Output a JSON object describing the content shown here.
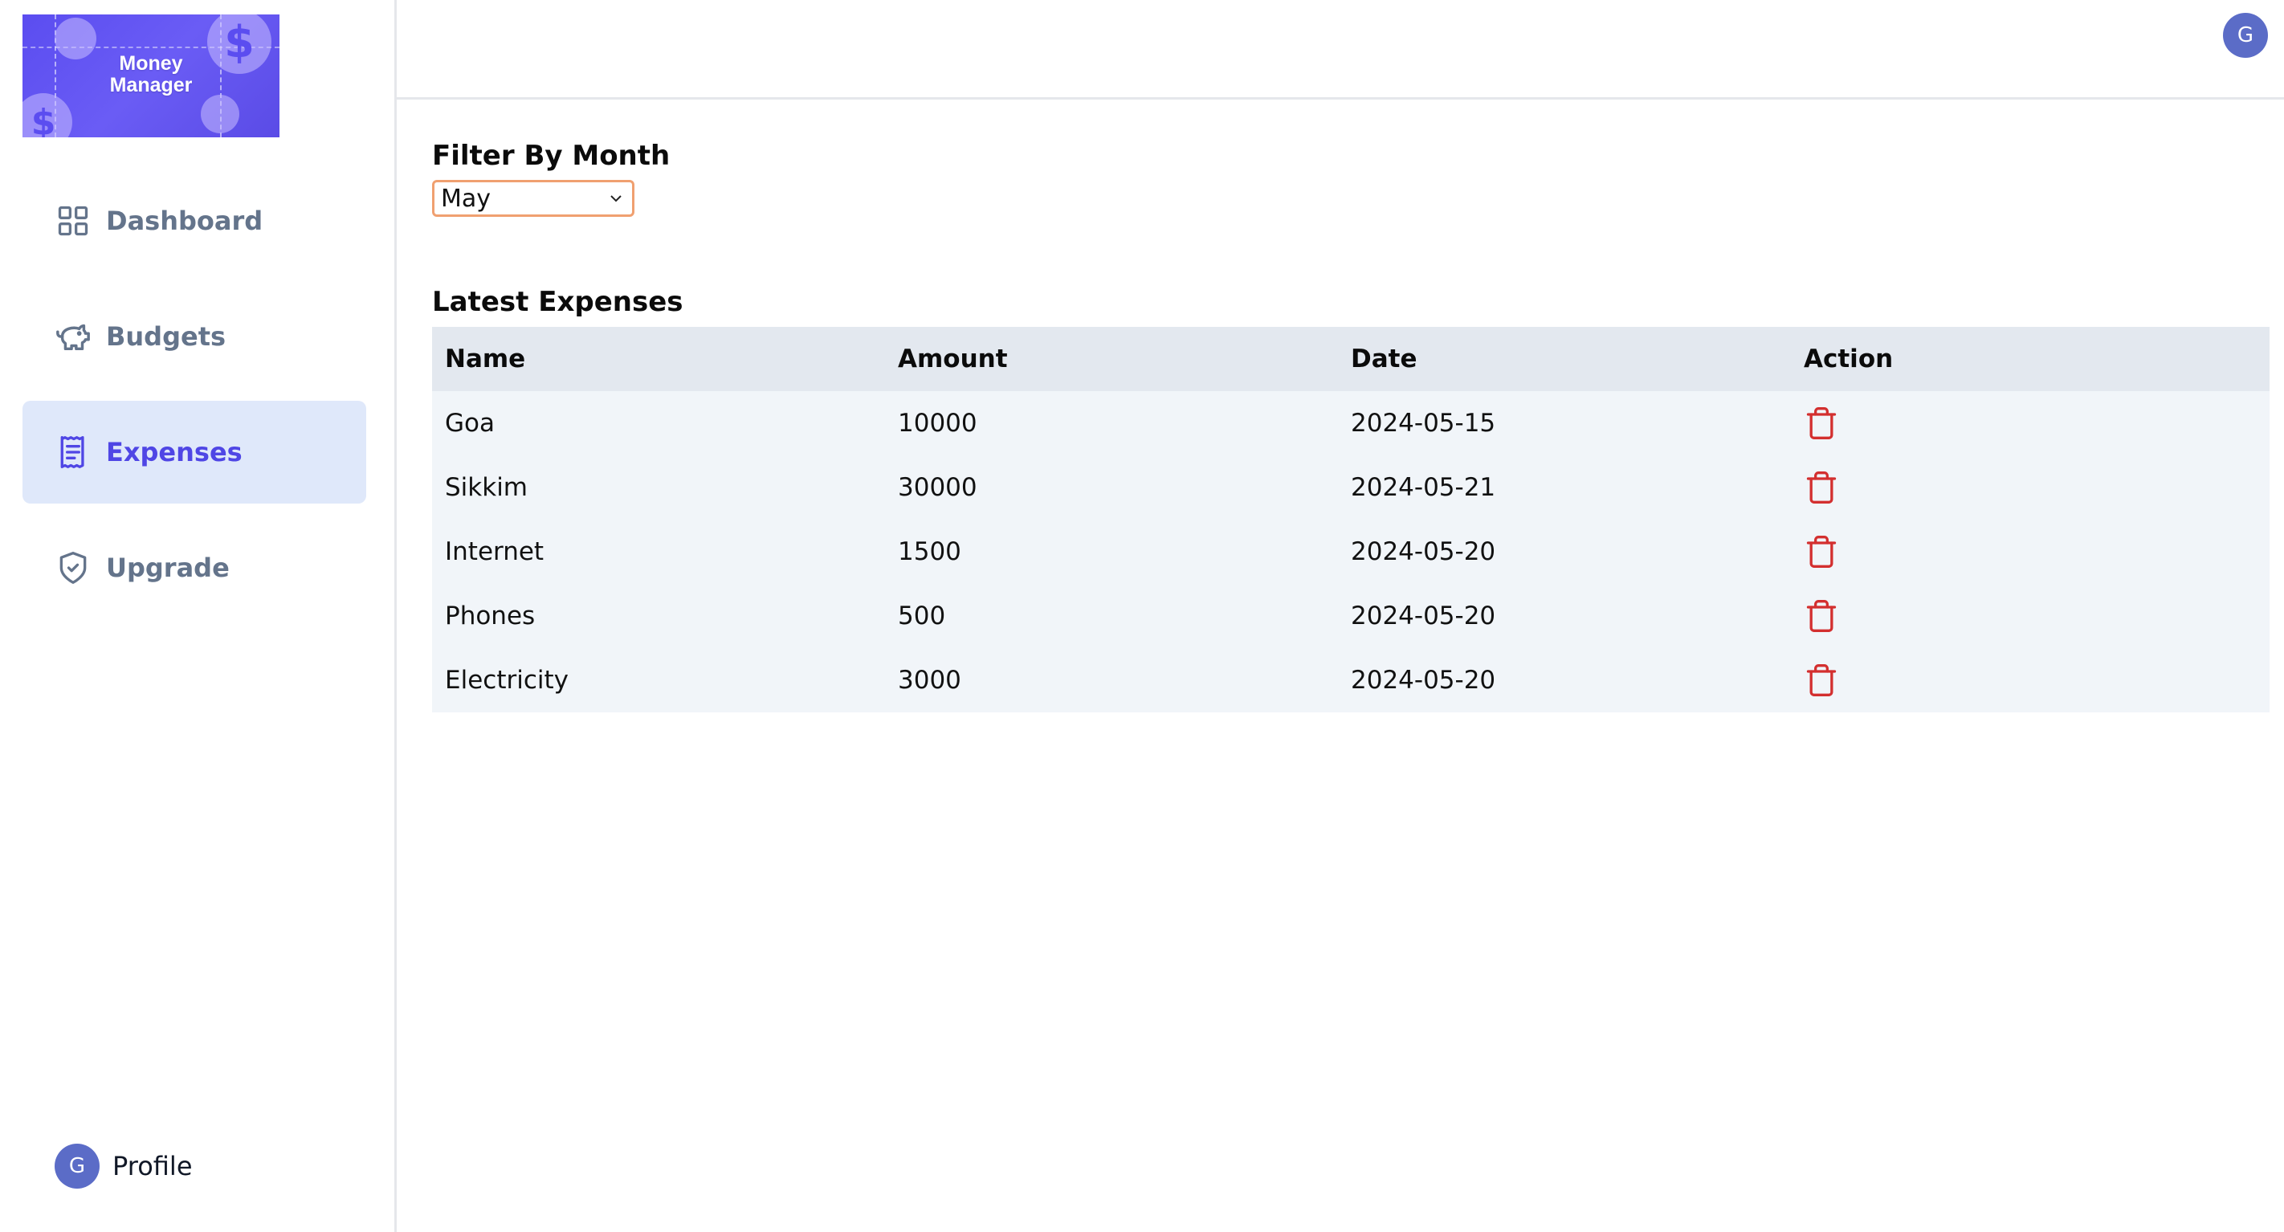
{
  "logo": {
    "line1": "Money",
    "line2": "Manager",
    "brand_color": "#5b4df0"
  },
  "sidebar": {
    "items": [
      {
        "label": "Dashboard",
        "icon": "grid-icon",
        "active": false
      },
      {
        "label": "Budgets",
        "icon": "piggy-bank-icon",
        "active": false
      },
      {
        "label": "Expenses",
        "icon": "receipt-icon",
        "active": true
      },
      {
        "label": "Upgrade",
        "icon": "shield-check-icon",
        "active": false
      }
    ],
    "profile": {
      "avatar_initial": "G",
      "label": "Profile"
    }
  },
  "header": {
    "avatar_initial": "G"
  },
  "filter": {
    "title": "Filter By Month",
    "selected_month": "May"
  },
  "expenses": {
    "title": "Latest Expenses",
    "columns": [
      "Name",
      "Amount",
      "Date",
      "Action"
    ],
    "rows": [
      {
        "name": "Goa",
        "amount": "10000",
        "date": "2024-05-15"
      },
      {
        "name": "Sikkim",
        "amount": "30000",
        "date": "2024-05-21"
      },
      {
        "name": "Internet",
        "amount": "1500",
        "date": "2024-05-20"
      },
      {
        "name": "Phones",
        "amount": "500",
        "date": "2024-05-20"
      },
      {
        "name": "Electricity",
        "amount": "3000",
        "date": "2024-05-20"
      }
    ],
    "delete_icon": "trash-icon",
    "delete_color": "#d32f2f"
  },
  "colors": {
    "accent": "#4f46e5",
    "active_bg": "#dfe8fa",
    "avatar_bg": "#5b6cc7",
    "select_border": "#f0a070"
  }
}
